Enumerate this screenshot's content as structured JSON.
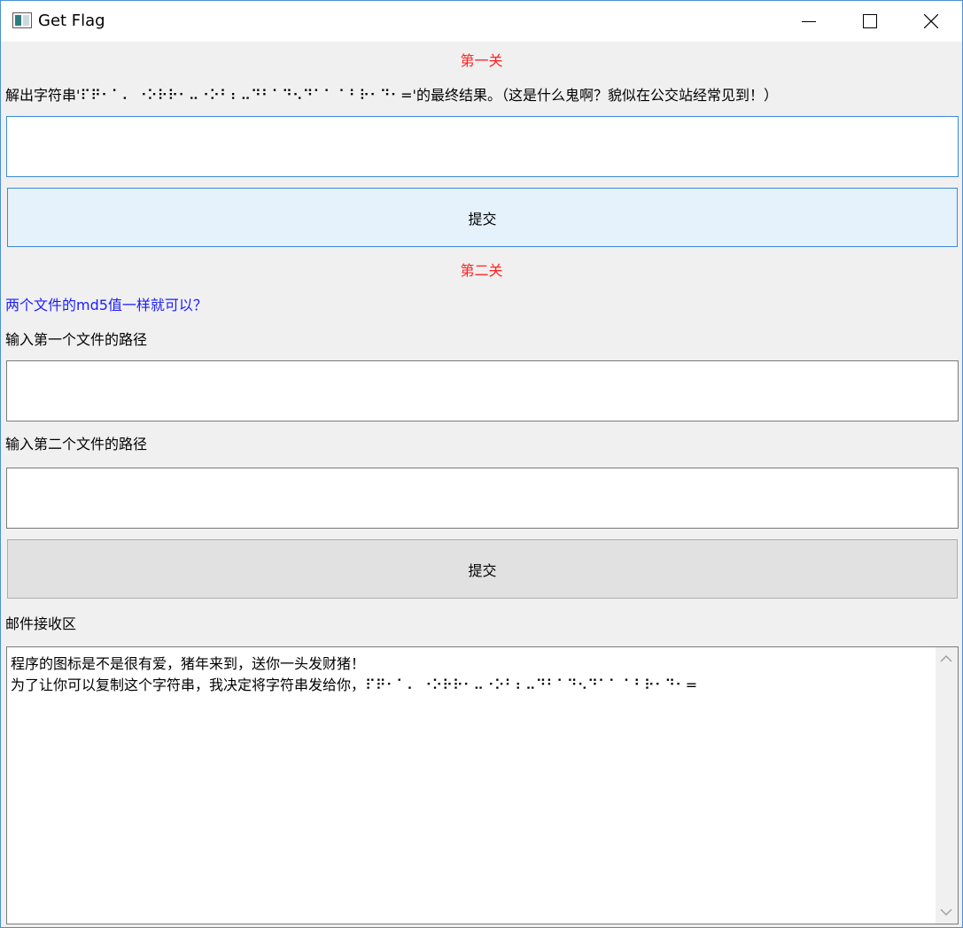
{
  "window": {
    "title": "Get Flag"
  },
  "level1": {
    "heading": "第一关",
    "prompt": "解出字符串'⠏⠟⠂⠁⠄ ⠐⠕⠗⠗⠂⠤⠐⠕⠃⠆⠤⠙⠃⠁⠙⠢⠙⠁⠁ ⠁⠃⠗⠂⠙⠂='的最终结果。（这是什么鬼啊？貌似在公交站经常见到！）",
    "answer_value": "",
    "submit_label": "提交"
  },
  "level2": {
    "heading": "第二关",
    "hint": "两个文件的md5值一样就可以？",
    "file1_label": "输入第一个文件的路径",
    "file1_value": "",
    "file2_label": "输入第二个文件的路径",
    "file2_value": "",
    "submit_label": "提交"
  },
  "mail": {
    "label": "邮件接收区",
    "lines": [
      "程序的图标是不是很有爱，猪年来到，送你一头发财猪！",
      "为了让你可以复制这个字符串，我决定将字符串发给你，⠏⠟⠂⠁⠄ ⠐⠕⠗⠗⠂⠤⠐⠕⠃⠆⠤⠙⠃⠁⠙⠢⠙⠁⠁ ⠁⠃⠗⠂⠙⠂="
    ]
  },
  "colors": {
    "heading": "#ff2020",
    "hint": "#1c1cff",
    "focus_border": "#3c8ad8"
  },
  "icons": {
    "app": "window-app-icon",
    "minimize": "minimize-icon",
    "maximize": "maximize-icon",
    "close": "close-icon",
    "scroll_up": "chevron-up-icon",
    "scroll_down": "chevron-down-icon"
  }
}
